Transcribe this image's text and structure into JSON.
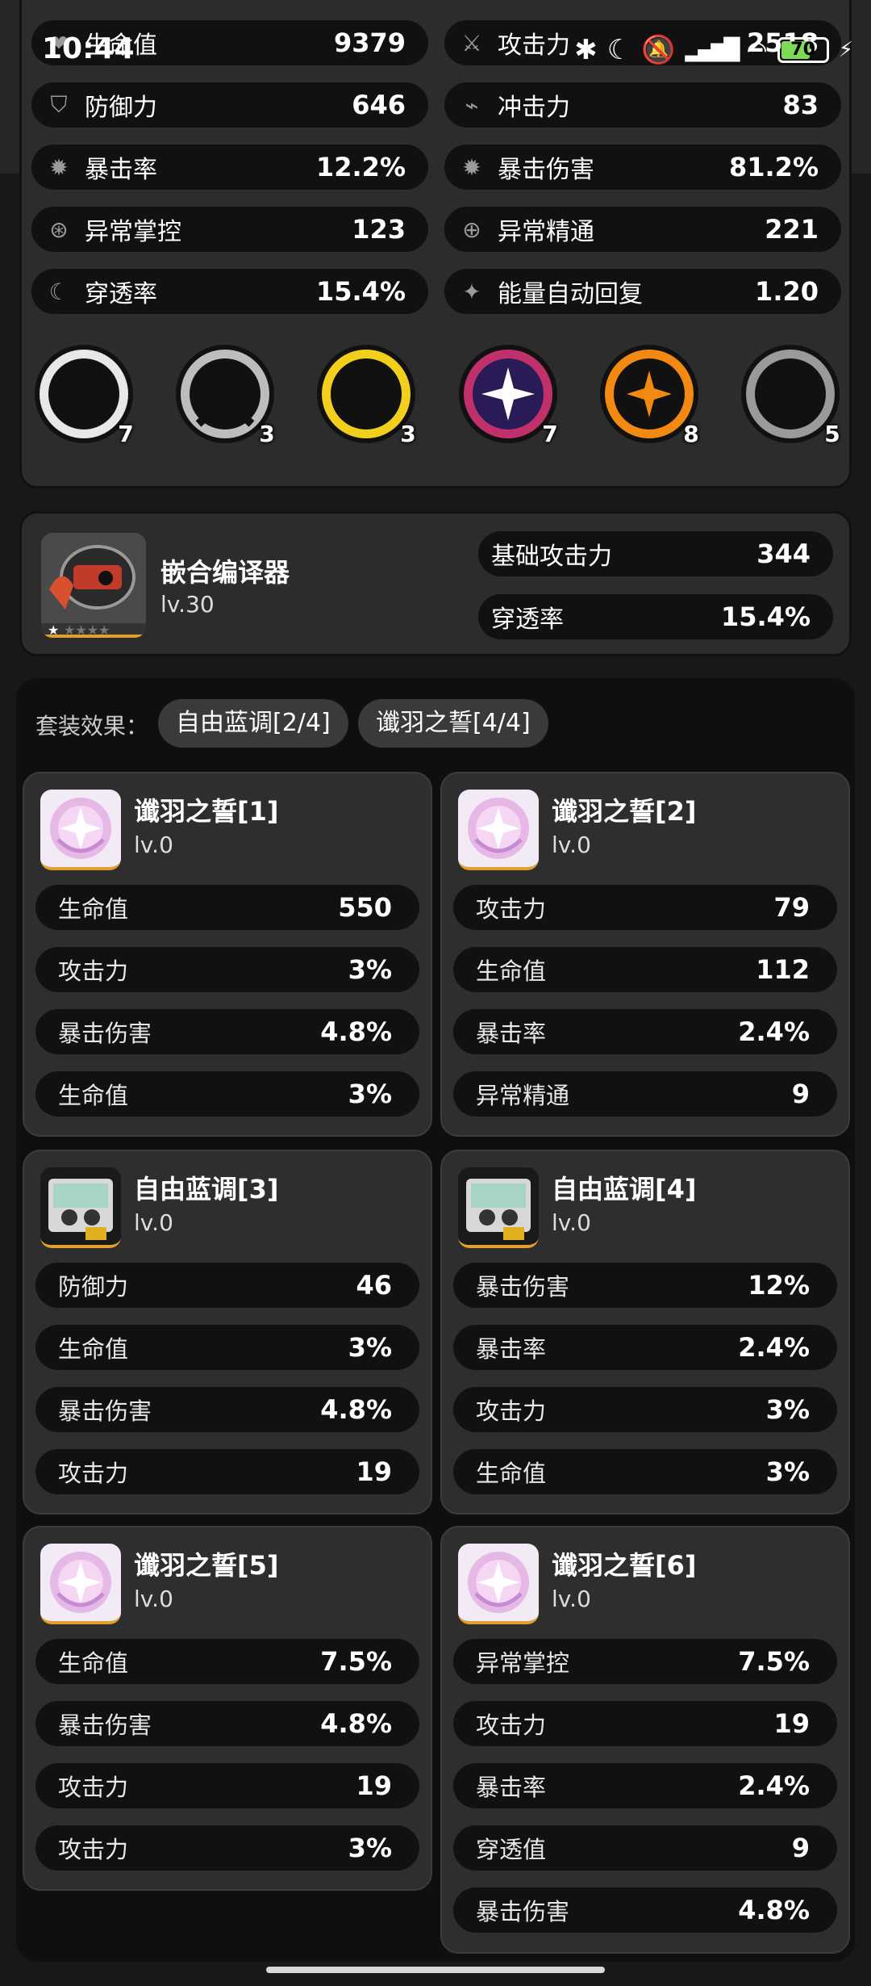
{
  "status_bar": {
    "time": "10:44",
    "battery": "70"
  },
  "stats": [
    {
      "label": "生命值",
      "value": "9379",
      "icon": "heart-icon"
    },
    {
      "label": "攻击力",
      "value": "2518",
      "icon": "sword-icon"
    },
    {
      "label": "防御力",
      "value": "646",
      "icon": "shield-icon"
    },
    {
      "label": "冲击力",
      "value": "83",
      "icon": "impact-icon"
    },
    {
      "label": "暴击率",
      "value": "12.2%",
      "icon": "crit-rate-icon"
    },
    {
      "label": "暴击伤害",
      "value": "81.2%",
      "icon": "crit-dmg-icon"
    },
    {
      "label": "异常掌控",
      "value": "123",
      "icon": "anomaly-control-icon"
    },
    {
      "label": "异常精通",
      "value": "221",
      "icon": "anomaly-mastery-icon"
    },
    {
      "label": "穿透率",
      "value": "15.4%",
      "icon": "pen-ratio-icon"
    },
    {
      "label": "能量自动回复",
      "value": "1.20",
      "icon": "energy-regen-icon"
    }
  ],
  "skills": [
    {
      "count": "7",
      "icon": "fist-skill-icon"
    },
    {
      "count": "3",
      "icon": "chevron-skill-icon"
    },
    {
      "count": "3",
      "icon": "swap-skill-icon"
    },
    {
      "count": "7",
      "icon": "star-skill-icon"
    },
    {
      "count": "8",
      "icon": "spiral-skill-icon"
    },
    {
      "count": "5",
      "icon": "wheel-skill-icon"
    }
  ],
  "weapon": {
    "name": "嵌合编译器",
    "level": "lv.30",
    "stats": [
      {
        "label": "基础攻击力",
        "value": "344"
      },
      {
        "label": "穿透率",
        "value": "15.4%"
      }
    ]
  },
  "set_effects": {
    "label": "套装效果：",
    "chips": [
      "自由蓝调[2/4]",
      "谶羽之誓[4/4]"
    ]
  },
  "discs": [
    {
      "name": "谶羽之誓[1]",
      "level": "lv.0",
      "type": "feather",
      "stats": [
        {
          "label": "生命值",
          "value": "550"
        },
        {
          "label": "攻击力",
          "value": "3%"
        },
        {
          "label": "暴击伤害",
          "value": "4.8%"
        },
        {
          "label": "生命值",
          "value": "3%"
        }
      ]
    },
    {
      "name": "谶羽之誓[2]",
      "level": "lv.0",
      "type": "feather",
      "stats": [
        {
          "label": "攻击力",
          "value": "79"
        },
        {
          "label": "生命值",
          "value": "112"
        },
        {
          "label": "暴击率",
          "value": "2.4%"
        },
        {
          "label": "异常精通",
          "value": "9"
        }
      ]
    },
    {
      "name": "自由蓝调[3]",
      "level": "lv.0",
      "type": "player",
      "stats": [
        {
          "label": "防御力",
          "value": "46"
        },
        {
          "label": "生命值",
          "value": "3%"
        },
        {
          "label": "暴击伤害",
          "value": "4.8%"
        },
        {
          "label": "攻击力",
          "value": "19"
        }
      ]
    },
    {
      "name": "自由蓝调[4]",
      "level": "lv.0",
      "type": "player",
      "stats": [
        {
          "label": "暴击伤害",
          "value": "12%"
        },
        {
          "label": "暴击率",
          "value": "2.4%"
        },
        {
          "label": "攻击力",
          "value": "3%"
        },
        {
          "label": "生命值",
          "value": "3%"
        }
      ]
    },
    {
      "name": "谶羽之誓[5]",
      "level": "lv.0",
      "type": "feather",
      "stats": [
        {
          "label": "生命值",
          "value": "7.5%"
        },
        {
          "label": "暴击伤害",
          "value": "4.8%"
        },
        {
          "label": "攻击力",
          "value": "19"
        },
        {
          "label": "攻击力",
          "value": "3%"
        }
      ]
    },
    {
      "name": "谶羽之誓[6]",
      "level": "lv.0",
      "type": "feather",
      "stats": [
        {
          "label": "异常掌控",
          "value": "7.5%"
        },
        {
          "label": "攻击力",
          "value": "19"
        },
        {
          "label": "暴击率",
          "value": "2.4%"
        },
        {
          "label": "穿透值",
          "value": "9"
        },
        {
          "label": "暴击伤害",
          "value": "4.8%"
        }
      ]
    }
  ]
}
